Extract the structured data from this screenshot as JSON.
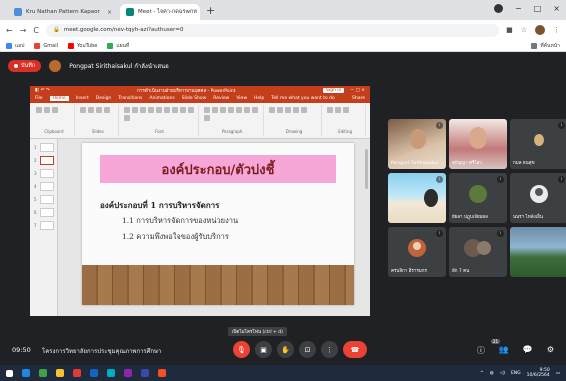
{
  "browser": {
    "tabs": [
      {
        "label": "Kru Nathan Pattern Kapaor",
        "fav_color": "#4a90d9",
        "close": "×"
      },
      {
        "label": "Meet - ไจคา-กดฉรwกห",
        "fav_color": "#00897b",
        "close": "×"
      }
    ],
    "new_tab": "+",
    "window_controls": [
      "−",
      "□",
      "×"
    ],
    "nav": {
      "back": "←",
      "forward": "→",
      "reload": "C"
    },
    "url": "meet.google.com/nev-tqyh-azi?authuser=0",
    "bookmarks": [
      {
        "label": "แอป",
        "color": "#4285f4"
      },
      {
        "label": "Gmail",
        "color": "#ea4335"
      },
      {
        "label": "YouTube",
        "color": "#ff0000"
      },
      {
        "label": "แผนที่",
        "color": "#34a853"
      }
    ],
    "reading_list": "ที่คั่นหน้า"
  },
  "meet": {
    "recording_label": "บันทึก",
    "presenter": "Pongpat Sirithaisakul กำลังนำเสนอ",
    "clock": "09:50",
    "meeting_title": "โครงการวิทยาลัยการประชุมคุณภาพการศึกษา",
    "tooltip": "เปิดไมโครโฟน (ctrl + d)",
    "controls": [
      {
        "name": "mic-button",
        "glyph": "🎙",
        "red": true
      },
      {
        "name": "camera-button",
        "glyph": "▣",
        "red": false
      },
      {
        "name": "raise-hand-button",
        "glyph": "✋",
        "red": false
      },
      {
        "name": "present-button",
        "glyph": "⊡",
        "red": false
      },
      {
        "name": "more-options-button",
        "glyph": "⋮",
        "red": false
      },
      {
        "name": "leave-call-button",
        "glyph": "☎",
        "red": true
      }
    ],
    "right_controls": [
      "ⓘ",
      "👥",
      "💬",
      "⚙"
    ],
    "participant_count": "21",
    "participants": [
      {
        "name": "Pongpat Sirithaisakul"
      },
      {
        "name": "สุกัญญา ศรีไสว"
      },
      {
        "name": "กมล ธนสุข"
      },
      {
        "name": ""
      },
      {
        "name": "ยัยลา ปฎุบเจ้ยมผล"
      },
      {
        "name": "นนรา ไหลังเย็น"
      },
      {
        "name": "ครบลิกา อิรารมกร"
      },
      {
        "name": "อีก 7 คน"
      },
      {
        "name": ""
      }
    ]
  },
  "ppt": {
    "window_title": "การดำเนินงานฝ่ายบริหารงานบุคคล - PowerPoint",
    "sign_in": "Sign in",
    "tabs": [
      "File",
      "Home",
      "Insert",
      "Design",
      "Transitions",
      "Animations",
      "Slide Show",
      "Review",
      "View",
      "Help",
      "Tell me what you want to do",
      "Share"
    ],
    "ribbon_groups": [
      "Clipboard",
      "Slides",
      "Font",
      "Paragraph",
      "Drawing",
      "Editing"
    ],
    "slide_numbers": [
      "1",
      "2",
      "3",
      "4",
      "5",
      "6",
      "7"
    ],
    "slide": {
      "title": "องค์ประกอบ/ตัวบ่งชี้",
      "heading": "องค์ประกอบที่ 1  การบริหารจัดการ",
      "items": [
        "1.1 การบริหารจัดการของหน่วยงาน",
        "1.2 ความพึงพอใจของผู้รับบริการ"
      ]
    }
  },
  "taskbar": {
    "apps": [
      "#1e88e5",
      "#43a047",
      "#fbc02d",
      "#e53935",
      "#1565c0",
      "#00acc1",
      "#8e24aa",
      "#3949ab",
      "#f4511e"
    ],
    "lang": "ENG",
    "time": "9:50",
    "date": "10/6/2564"
  }
}
